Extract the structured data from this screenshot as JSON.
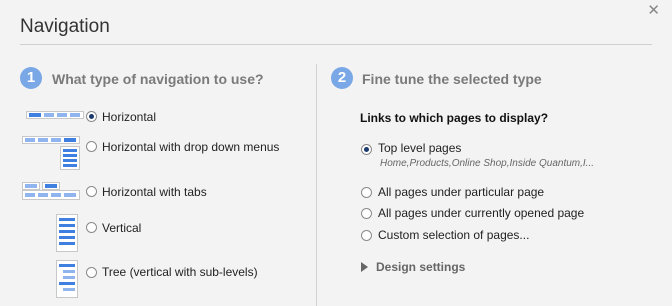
{
  "dialog": {
    "title": "Navigation",
    "close_icon": "close-icon"
  },
  "step1": {
    "number": "1",
    "title": "What type of navigation to use?",
    "options": [
      {
        "label": "Horizontal",
        "icon": "horizontal-nav-icon",
        "selected": true
      },
      {
        "label": "Horizontal with drop down menus",
        "icon": "horizontal-dropdown-nav-icon",
        "selected": false
      },
      {
        "label": "Horizontal with tabs",
        "icon": "horizontal-tabs-nav-icon",
        "selected": false
      },
      {
        "label": "Vertical",
        "icon": "vertical-nav-icon",
        "selected": false
      },
      {
        "label": "Tree (vertical with sub-levels)",
        "icon": "tree-nav-icon",
        "selected": false
      }
    ]
  },
  "step2": {
    "number": "2",
    "title": "Fine tune the selected type",
    "links_heading": "Links to which pages to display?",
    "options": [
      {
        "label": "Top level pages",
        "note": "Home,Products,Online Shop,Inside Quantum,I...",
        "selected": true
      },
      {
        "label": "All pages under particular page",
        "selected": false
      },
      {
        "label": "All pages under currently opened page",
        "selected": false
      },
      {
        "label": "Custom selection of pages...",
        "selected": false
      }
    ],
    "design_settings": "Design settings"
  },
  "colors": {
    "accent": "#7aa7e6",
    "nav_icon_blue": "#3f7fe0",
    "background": "#f3f3f3"
  }
}
